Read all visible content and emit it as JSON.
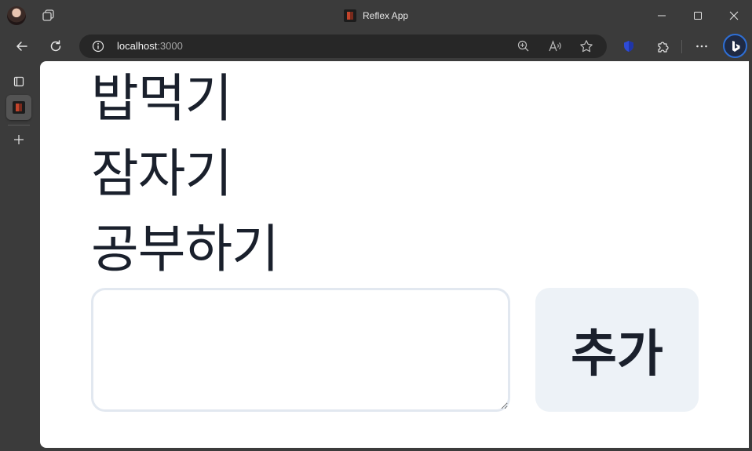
{
  "browser": {
    "window_title": "Reflex App",
    "address": {
      "host": "localhost",
      "port": ":3000"
    },
    "accent_color": "#2e6fd6"
  },
  "app": {
    "todos": [
      "밥먹기",
      "잠자기",
      "공부하기"
    ],
    "input": {
      "value": "",
      "placeholder": ""
    },
    "add_button_label": "추가"
  }
}
